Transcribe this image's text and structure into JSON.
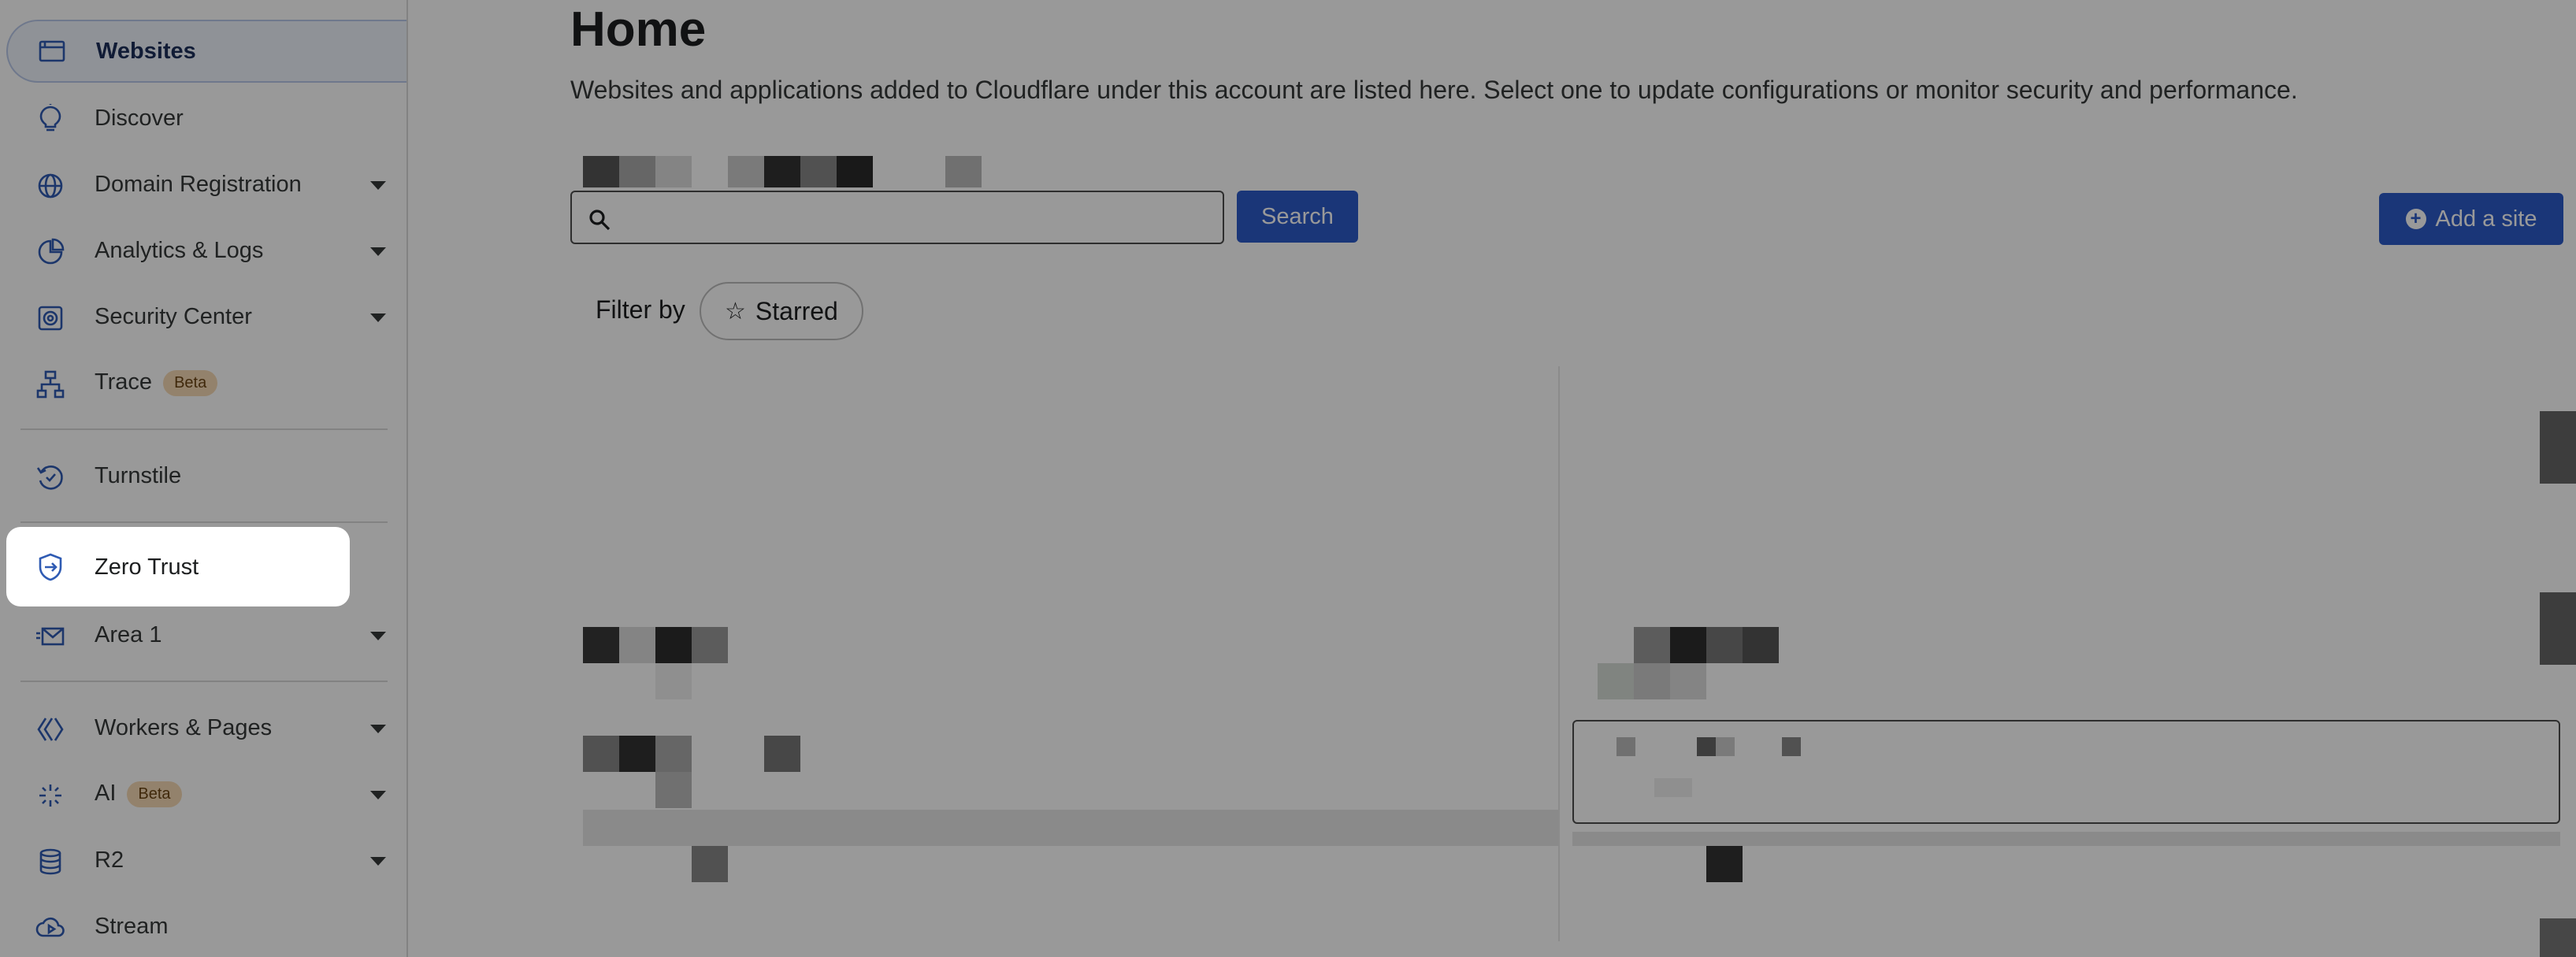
{
  "sidebar": {
    "items": [
      {
        "label": "Websites",
        "icon": "browser-window-icon",
        "active": true
      },
      {
        "label": "Discover",
        "icon": "lightbulb-icon"
      },
      {
        "label": "Domain Registration",
        "icon": "globe-icon",
        "expandable": true
      },
      {
        "label": "Analytics & Logs",
        "icon": "pie-chart-icon",
        "expandable": true
      },
      {
        "label": "Security Center",
        "icon": "security-target-icon",
        "expandable": true
      },
      {
        "label": "Trace",
        "icon": "hierarchy-icon",
        "badge": "Beta"
      },
      {
        "label": "Turnstile",
        "icon": "turnstile-icon"
      },
      {
        "label": "Zero Trust",
        "icon": "shield-arrow-icon",
        "highlighted": true
      },
      {
        "label": "Area 1",
        "icon": "email-envelope-icon",
        "expandable": true
      },
      {
        "label": "Workers & Pages",
        "icon": "workers-icon",
        "expandable": true
      },
      {
        "label": "AI",
        "icon": "sparkle-icon",
        "badge": "Beta",
        "expandable": true
      },
      {
        "label": "R2",
        "icon": "database-icon",
        "expandable": true
      },
      {
        "label": "Stream",
        "icon": "cloud-play-icon"
      }
    ]
  },
  "main": {
    "title": "Home",
    "description": "Websites and applications added to Cloudflare under this account are listed here. Select one to update configurations or monitor security and performance.",
    "search": {
      "placeholder": "",
      "value": ""
    },
    "search_button": "Search",
    "add_site_button": "Add a site",
    "filter_label": "Filter by",
    "filter_chip": "Starred"
  },
  "colors": {
    "accent": "#2c5bc8",
    "icon": "#2f5bb3",
    "active_bg": "#eef3fc",
    "badge_bg": "#f6d9b4",
    "overlay": "rgba(0,0,0,0.40)"
  }
}
